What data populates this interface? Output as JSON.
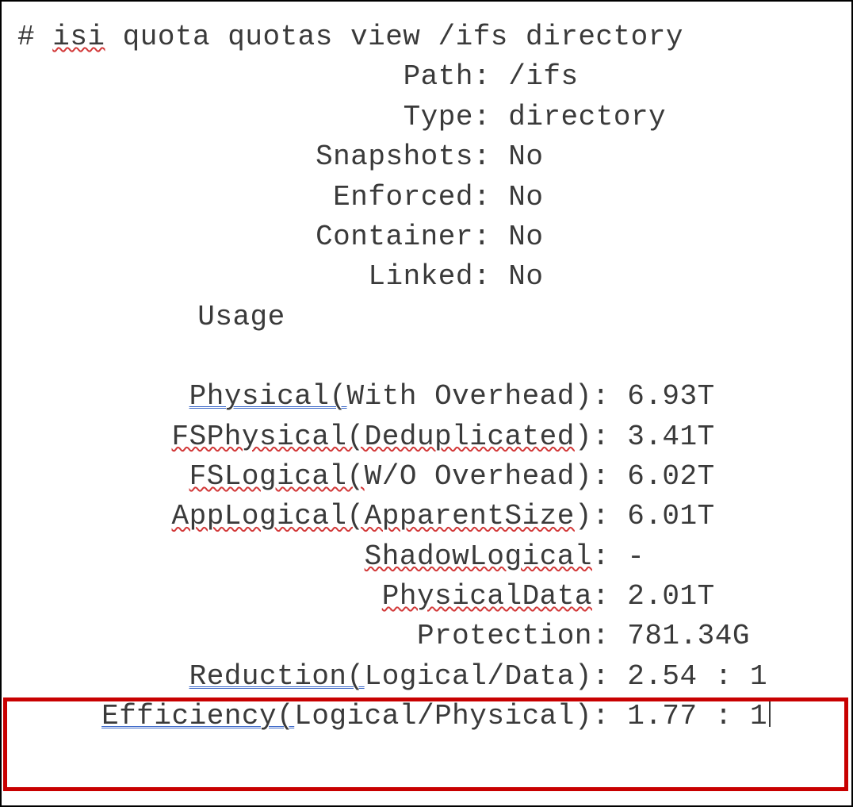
{
  "command": {
    "prompt": "# ",
    "isi": "isi",
    "rest": " quota quotas view /ifs directory"
  },
  "meta": [
    {
      "label": "Path",
      "value": "/ifs",
      "wavy": false
    },
    {
      "label": "Type",
      "value": "directory",
      "wavy": false
    },
    {
      "label": "Snapshots",
      "value": "No",
      "wavy": false
    },
    {
      "label": "Enforced",
      "value": "No",
      "wavy": false
    },
    {
      "label": "Container",
      "value": "No",
      "wavy": false
    },
    {
      "label": "Linked",
      "value": "No",
      "wavy": false
    }
  ],
  "usage_heading": "Usage",
  "usage": [
    {
      "styled": "Physical(",
      "styledClass": "dbl-blue",
      "plain": "With Overhead)",
      "value": "6.93T"
    },
    {
      "styled": "FSPhysical(Deduplicated",
      "styledClass": "wavy-red",
      "plain": ")",
      "value": "3.41T"
    },
    {
      "styled": "FSLogical(",
      "styledClass": "wavy-red",
      "plain": "W/O Overhead)",
      "value": "6.02T"
    },
    {
      "styled": "AppLogical(ApparentSize",
      "styledClass": "wavy-red",
      "plain": ")",
      "value": "6.01T"
    },
    {
      "styled": "ShadowLogical",
      "styledClass": "wavy-red",
      "plain": "",
      "value": "-"
    },
    {
      "styled": "PhysicalData",
      "styledClass": "wavy-red",
      "plain": "",
      "value": "2.01T"
    },
    {
      "styled": "",
      "styledClass": "",
      "plain": "Protection",
      "value": "781.34G"
    }
  ],
  "highlighted": [
    {
      "styled": "Reduction(",
      "styledClass": "dbl-blue",
      "plain": "Logical/Data)",
      "value": "2.54 : 1"
    },
    {
      "styled": "Efficiency(",
      "styledClass": "dbl-blue",
      "plain": "Logical/Physical)",
      "value": "1.77 : 1"
    }
  ]
}
